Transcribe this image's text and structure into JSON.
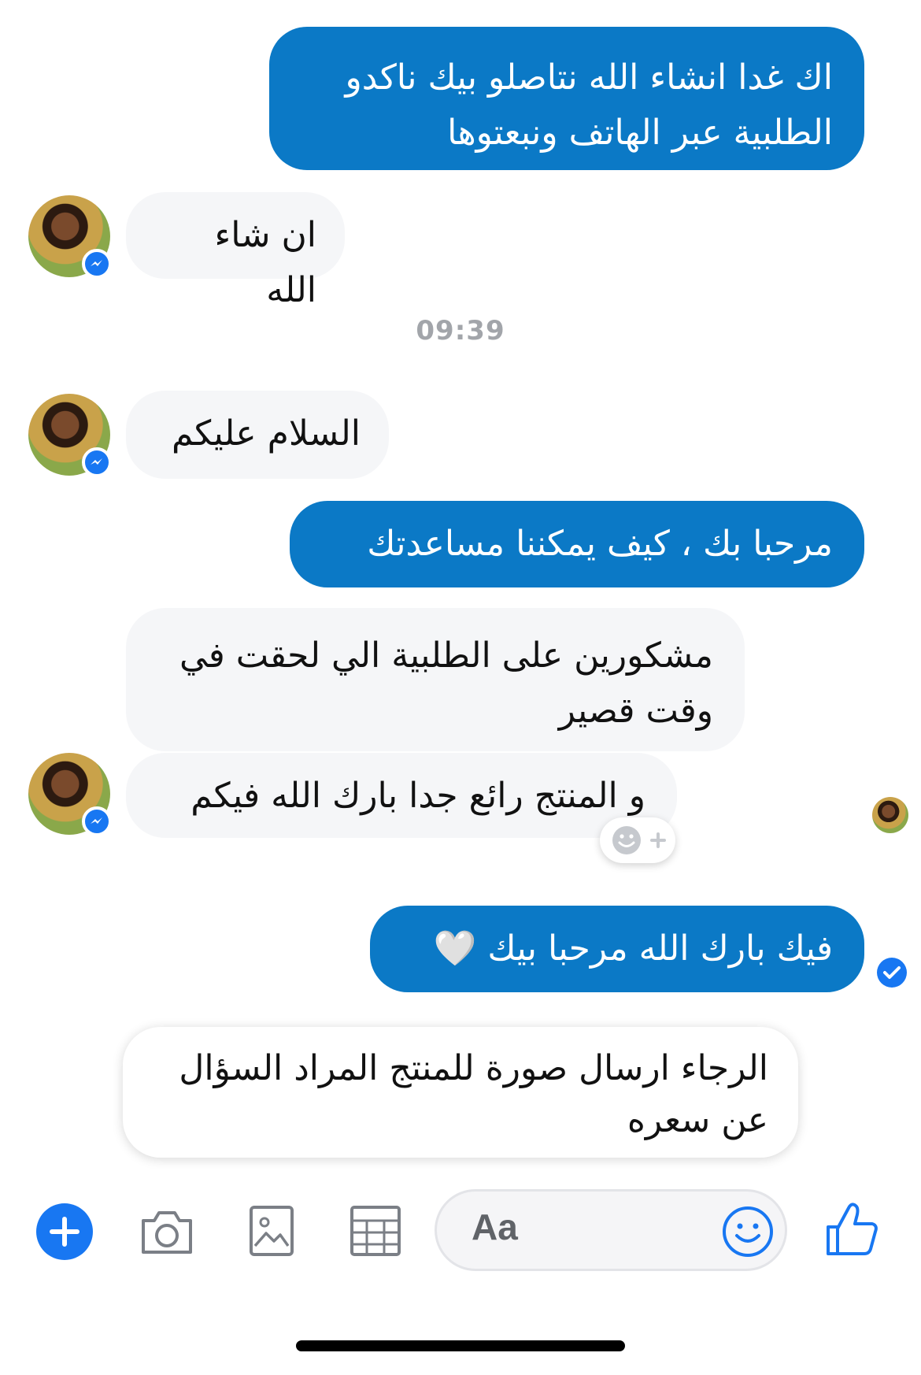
{
  "messages": {
    "m1": "اك غدا انشاء الله نتاصلو بيك ناكدو الطلبية عبر الهاتف ونبعتوها",
    "m2": "ان شاء الله",
    "m3": "السلام عليكم",
    "m4": "مرحبا بك ، كيف يمكننا مساعدتك",
    "m5": "مشكورين على الطلبية الي لحقت في وقت قصير",
    "m6": "و المنتج رائع جدا بارك الله فيكم",
    "m7": "فيك بارك الله مرحبا بيك 🤍"
  },
  "timestamp": "09:39",
  "draft": "الرجاء ارسال صورة للمنتج المراد السؤال عن سعره",
  "composer": {
    "placeholder": "Aa",
    "icons": [
      "plus-icon",
      "camera-icon",
      "gallery-icon",
      "sticker-icon",
      "emoji-icon",
      "like-icon"
    ]
  },
  "colors": {
    "outgoing": "#0b79c6",
    "incoming": "#f5f6f8",
    "accent": "#1877f2"
  }
}
